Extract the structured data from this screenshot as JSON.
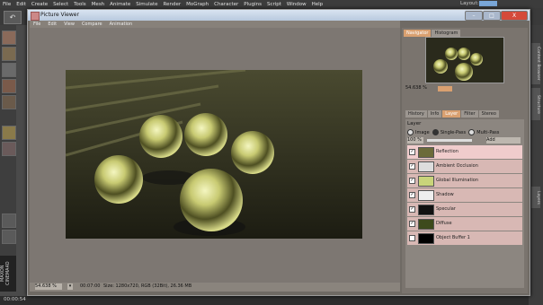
{
  "app": {
    "menu": [
      "File",
      "Edit",
      "Create",
      "Select",
      "Tools",
      "Mesh",
      "Animate",
      "Simulate",
      "Render",
      "MoGraph",
      "Character",
      "Plugins",
      "Script",
      "Window",
      "Help"
    ],
    "layout_label": "Layout:",
    "logo_text": "MAXON CINEMA4D",
    "timecode": "00:00:54"
  },
  "right_strip": [
    "Content Browser",
    "Structure",
    "Layers"
  ],
  "window": {
    "title": "Picture Viewer",
    "menu": [
      "File",
      "Edit",
      "View",
      "Compare",
      "Animation"
    ],
    "buttons": {
      "min": "–",
      "max": "□",
      "close": "X"
    },
    "status": {
      "zoom": "54.638 %",
      "time": "00:07:00",
      "info": "Size: 1280x720, RGB (32Bit), 26.36 MB"
    }
  },
  "panel": {
    "top_tabs": [
      "Navigator",
      "Histogram"
    ],
    "nav_zoom": "54.638 %",
    "mid_tabs": [
      "History",
      "Info",
      "Layer",
      "Filter",
      "Stereo"
    ],
    "layer": {
      "title": "Layer",
      "modes": [
        "Image",
        "Single-Pass",
        "Multi-Pass"
      ],
      "opacity": "100 %",
      "blend": "Add",
      "items": [
        {
          "name": "Reflection",
          "checked": true,
          "thumb": "#6b6b3a"
        },
        {
          "name": "Ambient Occlusion",
          "checked": true,
          "thumb": "#ddd"
        },
        {
          "name": "Global Illumination",
          "checked": true,
          "thumb": "#c9d47a"
        },
        {
          "name": "Shadow",
          "checked": true,
          "thumb": "#eee"
        },
        {
          "name": "Specular",
          "checked": true,
          "thumb": "#111"
        },
        {
          "name": "Diffuse",
          "checked": true,
          "thumb": "#3d4a1c"
        },
        {
          "name": "Object Buffer 1",
          "checked": false,
          "thumb": "#000"
        }
      ]
    }
  },
  "colors": {
    "accent": "#d9a070",
    "selected_row": "#f0cccc"
  }
}
